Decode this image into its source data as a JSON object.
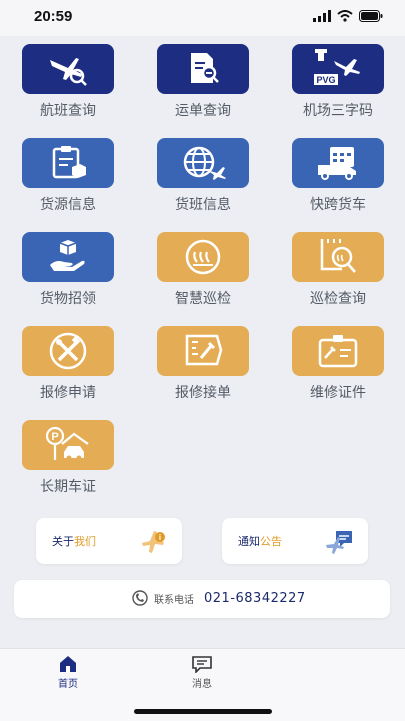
{
  "status": {
    "time": "20:59"
  },
  "tiles": [
    {
      "label": "航班查询",
      "icon": "plane-search-icon",
      "color": "navy"
    },
    {
      "label": "运单查询",
      "icon": "document-search-icon",
      "color": "navy"
    },
    {
      "label": "机场三字码",
      "icon": "airport-code-icon",
      "color": "navy",
      "badge": "PVG"
    },
    {
      "label": "货源信息",
      "icon": "clipboard-box-icon",
      "color": "blue"
    },
    {
      "label": "货班信息",
      "icon": "globe-plane-icon",
      "color": "blue"
    },
    {
      "label": "快跨货车",
      "icon": "truck-calendar-icon",
      "color": "blue"
    },
    {
      "label": "货物招领",
      "icon": "hand-box-icon",
      "color": "blue"
    },
    {
      "label": "智慧巡检",
      "icon": "inspection-icon",
      "color": "gold"
    },
    {
      "label": "巡检查询",
      "icon": "inspection-query-icon",
      "color": "gold"
    },
    {
      "label": "报修申请",
      "icon": "tools-icon",
      "color": "gold"
    },
    {
      "label": "报修接单",
      "icon": "repair-order-icon",
      "color": "gold"
    },
    {
      "label": "维修证件",
      "icon": "repair-badge-icon",
      "color": "gold"
    },
    {
      "label": "长期车证",
      "icon": "parking-car-icon",
      "color": "gold"
    }
  ],
  "about": {
    "prefix": "关于",
    "highlight": "我们"
  },
  "notice": {
    "prefix": "通知",
    "highlight": "公告"
  },
  "contact": {
    "label": "联系电话",
    "number": "021-68342227"
  },
  "tabs": [
    {
      "label": "首页",
      "icon": "home-icon"
    },
    {
      "label": "消息",
      "icon": "message-icon"
    }
  ],
  "colors": {
    "navy": "#1c2d82",
    "blue": "#3a64b4",
    "gold": "#e4ad55",
    "orange_text": "#e09a25"
  }
}
